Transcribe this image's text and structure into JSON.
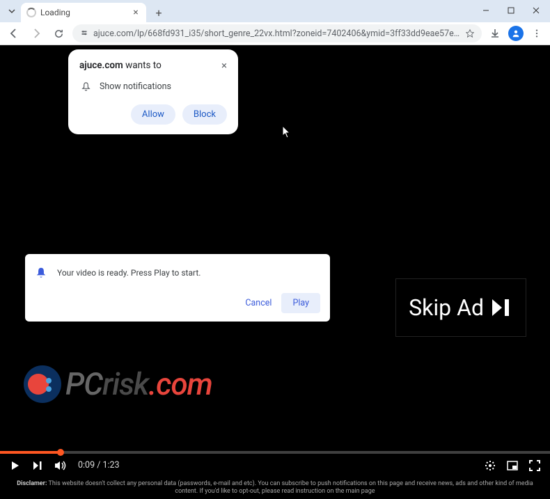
{
  "tab": {
    "title": "Loading"
  },
  "url": "ajuce.com/lp/668fd931_i35/short_genre_22vx.html?zoneid=7402406&ymid=3ff33dd9eae57e57dbbd112b9c57...",
  "permission": {
    "site": "ajuce.com",
    "suffix": " wants to",
    "item": "Show notifications",
    "allow": "Allow",
    "block": "Block"
  },
  "ready_modal": {
    "message": "Your video is ready. Press Play to start.",
    "cancel": "Cancel",
    "play": "Play"
  },
  "skip_ad": {
    "label": "Skip Ad"
  },
  "watermark": {
    "text1": "PC",
    "text2": "risk",
    "text3": ".com"
  },
  "video": {
    "current_time": "0:09",
    "duration": "1:23"
  },
  "disclaimer": {
    "label": "Disclamer:",
    "text": " This website doesn't collect any personal data (passwords, e-mail and etc). You can subscribe to push notifications on this page and receive news, ads and other kind of media content. If you'd like to opt-out, please read instruction on the main page"
  }
}
